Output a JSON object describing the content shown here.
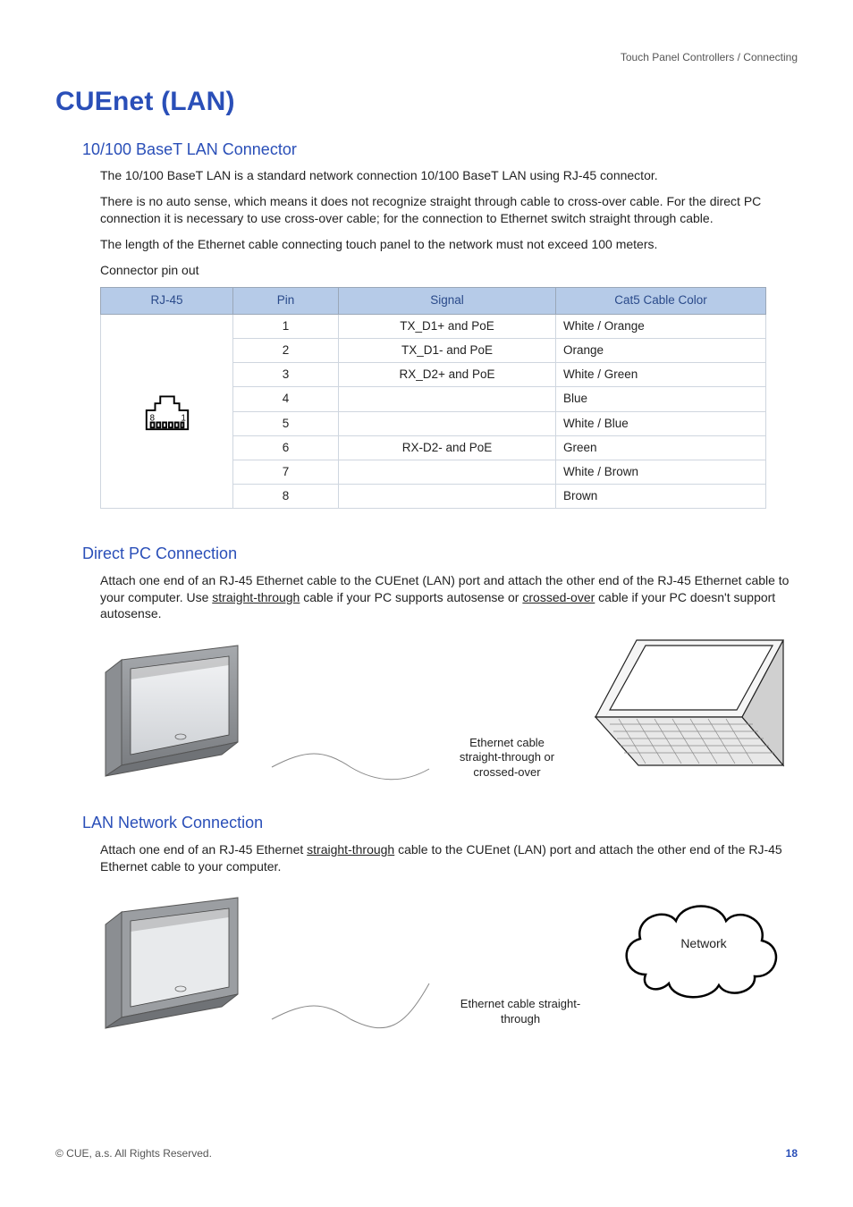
{
  "header": {
    "crumb": "Touch Panel Controllers / Connecting"
  },
  "title": "CUEnet (LAN)",
  "sec1": {
    "heading": "10/100 BaseT LAN Connector",
    "p1": "The 10/100 BaseT LAN is a standard network connection 10/100 BaseT LAN using RJ-45 connector.",
    "p2": "There is no auto sense, which means it does not recognize straight through cable to cross-over cable. For the direct PC connection it is necessary to use cross-over cable; for the connection to Ethernet switch straight through cable.",
    "p3": "The length of the Ethernet cable connecting touch panel to the network must not exceed 100 meters.",
    "p4": "Connector pin out",
    "table": {
      "headers": {
        "c1": "RJ-45",
        "c2": "Pin",
        "c3": "Signal",
        "c4": "Cat5 Cable Color"
      },
      "rows": [
        {
          "pin": "1",
          "signal": "TX_D1+ and PoE",
          "color": "White / Orange"
        },
        {
          "pin": "2",
          "signal": "TX_D1- and PoE",
          "color": "Orange"
        },
        {
          "pin": "3",
          "signal": "RX_D2+ and PoE",
          "color": "White / Green"
        },
        {
          "pin": "4",
          "signal": "",
          "color": "Blue"
        },
        {
          "pin": "5",
          "signal": "",
          "color": "White / Blue"
        },
        {
          "pin": "6",
          "signal": "RX-D2- and PoE",
          "color": "Green"
        },
        {
          "pin": "7",
          "signal": "",
          "color": "White / Brown"
        },
        {
          "pin": "8",
          "signal": "",
          "color": "Brown"
        }
      ],
      "rj45_labels": {
        "left": "8",
        "right": "1"
      }
    }
  },
  "sec2": {
    "heading": "Direct PC Connection",
    "p1a": "Attach one end of an RJ-45 Ethernet cable to the CUEnet (LAN) port and attach the other end of the RJ-45 Ethernet cable to your computer. Use ",
    "p1u1": "straight-through",
    "p1b": " cable if your PC supports autosense or ",
    "p1u2": "crossed-over",
    "p1c": " cable if your PC doesn't support autosense.",
    "cable_line1": "Ethernet cable",
    "cable_line2": "straight-through or crossed-over"
  },
  "sec3": {
    "heading": "LAN Network Connection",
    "p1a": "Attach one end of an RJ-45 Ethernet ",
    "p1u1": "straight-through",
    "p1b": " cable to the CUEnet (LAN) port and attach the other end of the RJ-45 Ethernet cable to your computer.",
    "cable_line1": "Ethernet cable straight-through",
    "cloud_label": "Network"
  },
  "footer": {
    "copyright": "© CUE, a.s. All Rights Reserved.",
    "page": "18"
  }
}
